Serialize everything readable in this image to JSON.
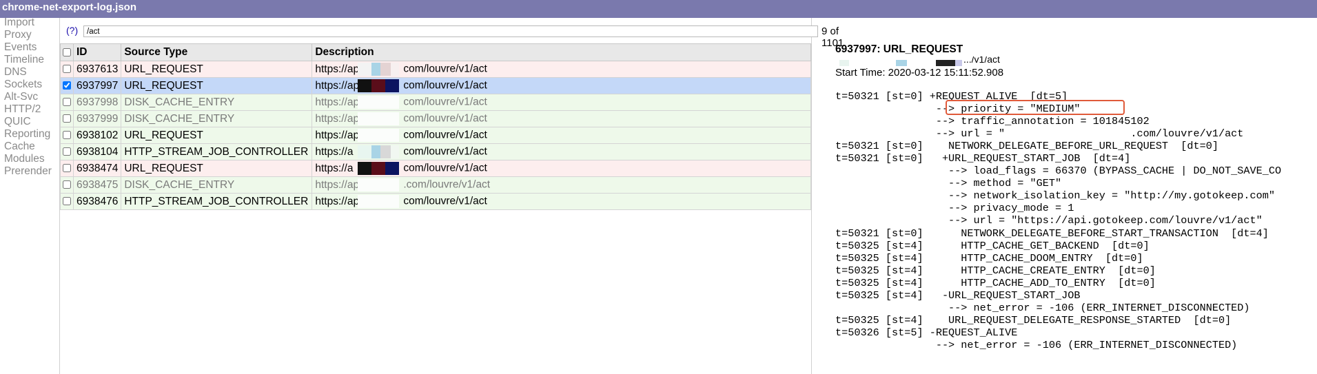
{
  "window": {
    "title": "chrome-net-export-log.json"
  },
  "sidebar": {
    "items": [
      {
        "label": "Import"
      },
      {
        "label": "Proxy"
      },
      {
        "label": "Events"
      },
      {
        "label": "Timeline"
      },
      {
        "label": "DNS"
      },
      {
        "label": "Sockets"
      },
      {
        "label": "Alt-Svc"
      },
      {
        "label": "HTTP/2"
      },
      {
        "label": "QUIC"
      },
      {
        "label": "Reporting"
      },
      {
        "label": "Cache"
      },
      {
        "label": "Modules"
      },
      {
        "label": "Prerender"
      }
    ]
  },
  "filter": {
    "help_label": "(?)",
    "value": "/act",
    "match_count": "9 of 1101"
  },
  "table": {
    "headers": {
      "id": "ID",
      "source_type": "Source Type",
      "description": "Description"
    },
    "rows": [
      {
        "id": "6937613",
        "source_type": "URL_REQUEST",
        "desc_prefix": "https://ap",
        "desc_suffix": "com/louvre/v1/act",
        "checked": false,
        "style": "red"
      },
      {
        "id": "6937997",
        "source_type": "URL_REQUEST",
        "desc_prefix": "https://ap",
        "desc_suffix": "com/louvre/v1/act",
        "checked": true,
        "style": "selected"
      },
      {
        "id": "6937998",
        "source_type": "DISK_CACHE_ENTRY",
        "desc_prefix": "https://ap",
        "desc_suffix": "com/louvre/v1/act",
        "checked": false,
        "style": "green-gray"
      },
      {
        "id": "6937999",
        "source_type": "DISK_CACHE_ENTRY",
        "desc_prefix": "https://ap",
        "desc_suffix": "com/louvre/v1/act",
        "checked": false,
        "style": "green-gray"
      },
      {
        "id": "6938102",
        "source_type": "URL_REQUEST",
        "desc_prefix": "https://ap",
        "desc_suffix": "com/louvre/v1/act",
        "checked": false,
        "style": "green"
      },
      {
        "id": "6938104",
        "source_type": "HTTP_STREAM_JOB_CONTROLLER",
        "desc_prefix": "https://a",
        "desc_suffix": "com/louvre/v1/act",
        "checked": false,
        "style": "green"
      },
      {
        "id": "6938474",
        "source_type": "URL_REQUEST",
        "desc_prefix": "https://a",
        "desc_suffix": "com/louvre/v1/act",
        "checked": false,
        "style": "red"
      },
      {
        "id": "6938475",
        "source_type": "DISK_CACHE_ENTRY",
        "desc_prefix": "https://ap",
        "desc_suffix": ".com/louvre/v1/act",
        "checked": false,
        "style": "green-gray"
      },
      {
        "id": "6938476",
        "source_type": "HTTP_STREAM_JOB_CONTROLLER",
        "desc_prefix": "https://ap",
        "desc_suffix": "com/louvre/v1/act",
        "checked": false,
        "style": "green"
      }
    ]
  },
  "detail": {
    "title": "6937997: URL_REQUEST",
    "partial_line": ".../v1/act",
    "start_time": "Start Time: 2020-03-12 15:11:52.908",
    "log_lines": [
      "t=50321 [st=0] +REQUEST_ALIVE  [dt=5]",
      "                --> priority = \"MEDIUM\"",
      "                --> traffic_annotation = 101845102",
      "                --> url = \"                    .com/louvre/v1/act",
      "t=50321 [st=0]    NETWORK_DELEGATE_BEFORE_URL_REQUEST  [dt=0]",
      "t=50321 [st=0]   +URL_REQUEST_START_JOB  [dt=4]",
      "                  --> load_flags = 66370 (BYPASS_CACHE | DO_NOT_SAVE_CO",
      "                  --> method = \"GET\"",
      "                  --> network_isolation_key = \"http://my.gotokeep.com\"",
      "                  --> privacy_mode = 1",
      "                  --> url = \"https://api.gotokeep.com/louvre/v1/act\"",
      "t=50321 [st=0]      NETWORK_DELEGATE_BEFORE_START_TRANSACTION  [dt=4]",
      "t=50325 [st=4]      HTTP_CACHE_GET_BACKEND  [dt=0]",
      "t=50325 [st=4]      HTTP_CACHE_DOOM_ENTRY  [dt=0]",
      "t=50325 [st=4]      HTTP_CACHE_CREATE_ENTRY  [dt=0]",
      "t=50325 [st=4]      HTTP_CACHE_ADD_TO_ENTRY  [dt=0]",
      "t=50325 [st=4]   -URL_REQUEST_START_JOB",
      "                  --> net_error = -106 (ERR_INTERNET_DISCONNECTED)",
      "t=50325 [st=4]    URL_REQUEST_DELEGATE_RESPONSE_STARTED  [dt=0]",
      "t=50326 [st=5] -REQUEST_ALIVE",
      "                --> net_error = -106 (ERR_INTERNET_DISCONNECTED)"
    ]
  },
  "colors": {
    "titlebar": "#7a79ad",
    "row_red": "#fdeeee",
    "row_green": "#eef9ea",
    "row_selected": "#c4d8f8",
    "highlight_box": "#e05a3a"
  }
}
